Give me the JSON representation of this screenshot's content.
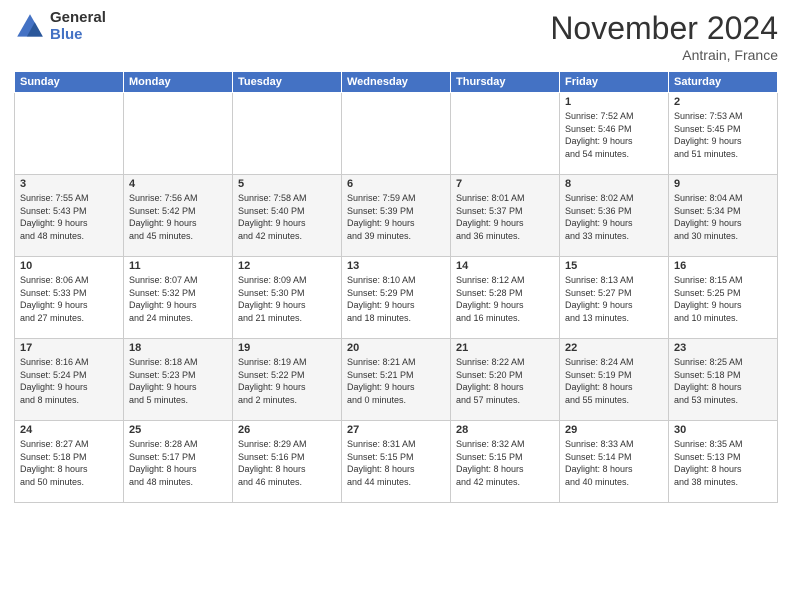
{
  "logo": {
    "general": "General",
    "blue": "Blue"
  },
  "header": {
    "month": "November 2024",
    "location": "Antrain, France"
  },
  "weekdays": [
    "Sunday",
    "Monday",
    "Tuesday",
    "Wednesday",
    "Thursday",
    "Friday",
    "Saturday"
  ],
  "weeks": [
    [
      {
        "day": "",
        "info": ""
      },
      {
        "day": "",
        "info": ""
      },
      {
        "day": "",
        "info": ""
      },
      {
        "day": "",
        "info": ""
      },
      {
        "day": "",
        "info": ""
      },
      {
        "day": "1",
        "info": "Sunrise: 7:52 AM\nSunset: 5:46 PM\nDaylight: 9 hours\nand 54 minutes."
      },
      {
        "day": "2",
        "info": "Sunrise: 7:53 AM\nSunset: 5:45 PM\nDaylight: 9 hours\nand 51 minutes."
      }
    ],
    [
      {
        "day": "3",
        "info": "Sunrise: 7:55 AM\nSunset: 5:43 PM\nDaylight: 9 hours\nand 48 minutes."
      },
      {
        "day": "4",
        "info": "Sunrise: 7:56 AM\nSunset: 5:42 PM\nDaylight: 9 hours\nand 45 minutes."
      },
      {
        "day": "5",
        "info": "Sunrise: 7:58 AM\nSunset: 5:40 PM\nDaylight: 9 hours\nand 42 minutes."
      },
      {
        "day": "6",
        "info": "Sunrise: 7:59 AM\nSunset: 5:39 PM\nDaylight: 9 hours\nand 39 minutes."
      },
      {
        "day": "7",
        "info": "Sunrise: 8:01 AM\nSunset: 5:37 PM\nDaylight: 9 hours\nand 36 minutes."
      },
      {
        "day": "8",
        "info": "Sunrise: 8:02 AM\nSunset: 5:36 PM\nDaylight: 9 hours\nand 33 minutes."
      },
      {
        "day": "9",
        "info": "Sunrise: 8:04 AM\nSunset: 5:34 PM\nDaylight: 9 hours\nand 30 minutes."
      }
    ],
    [
      {
        "day": "10",
        "info": "Sunrise: 8:06 AM\nSunset: 5:33 PM\nDaylight: 9 hours\nand 27 minutes."
      },
      {
        "day": "11",
        "info": "Sunrise: 8:07 AM\nSunset: 5:32 PM\nDaylight: 9 hours\nand 24 minutes."
      },
      {
        "day": "12",
        "info": "Sunrise: 8:09 AM\nSunset: 5:30 PM\nDaylight: 9 hours\nand 21 minutes."
      },
      {
        "day": "13",
        "info": "Sunrise: 8:10 AM\nSunset: 5:29 PM\nDaylight: 9 hours\nand 18 minutes."
      },
      {
        "day": "14",
        "info": "Sunrise: 8:12 AM\nSunset: 5:28 PM\nDaylight: 9 hours\nand 16 minutes."
      },
      {
        "day": "15",
        "info": "Sunrise: 8:13 AM\nSunset: 5:27 PM\nDaylight: 9 hours\nand 13 minutes."
      },
      {
        "day": "16",
        "info": "Sunrise: 8:15 AM\nSunset: 5:25 PM\nDaylight: 9 hours\nand 10 minutes."
      }
    ],
    [
      {
        "day": "17",
        "info": "Sunrise: 8:16 AM\nSunset: 5:24 PM\nDaylight: 9 hours\nand 8 minutes."
      },
      {
        "day": "18",
        "info": "Sunrise: 8:18 AM\nSunset: 5:23 PM\nDaylight: 9 hours\nand 5 minutes."
      },
      {
        "day": "19",
        "info": "Sunrise: 8:19 AM\nSunset: 5:22 PM\nDaylight: 9 hours\nand 2 minutes."
      },
      {
        "day": "20",
        "info": "Sunrise: 8:21 AM\nSunset: 5:21 PM\nDaylight: 9 hours\nand 0 minutes."
      },
      {
        "day": "21",
        "info": "Sunrise: 8:22 AM\nSunset: 5:20 PM\nDaylight: 8 hours\nand 57 minutes."
      },
      {
        "day": "22",
        "info": "Sunrise: 8:24 AM\nSunset: 5:19 PM\nDaylight: 8 hours\nand 55 minutes."
      },
      {
        "day": "23",
        "info": "Sunrise: 8:25 AM\nSunset: 5:18 PM\nDaylight: 8 hours\nand 53 minutes."
      }
    ],
    [
      {
        "day": "24",
        "info": "Sunrise: 8:27 AM\nSunset: 5:18 PM\nDaylight: 8 hours\nand 50 minutes."
      },
      {
        "day": "25",
        "info": "Sunrise: 8:28 AM\nSunset: 5:17 PM\nDaylight: 8 hours\nand 48 minutes."
      },
      {
        "day": "26",
        "info": "Sunrise: 8:29 AM\nSunset: 5:16 PM\nDaylight: 8 hours\nand 46 minutes."
      },
      {
        "day": "27",
        "info": "Sunrise: 8:31 AM\nSunset: 5:15 PM\nDaylight: 8 hours\nand 44 minutes."
      },
      {
        "day": "28",
        "info": "Sunrise: 8:32 AM\nSunset: 5:15 PM\nDaylight: 8 hours\nand 42 minutes."
      },
      {
        "day": "29",
        "info": "Sunrise: 8:33 AM\nSunset: 5:14 PM\nDaylight: 8 hours\nand 40 minutes."
      },
      {
        "day": "30",
        "info": "Sunrise: 8:35 AM\nSunset: 5:13 PM\nDaylight: 8 hours\nand 38 minutes."
      }
    ]
  ]
}
